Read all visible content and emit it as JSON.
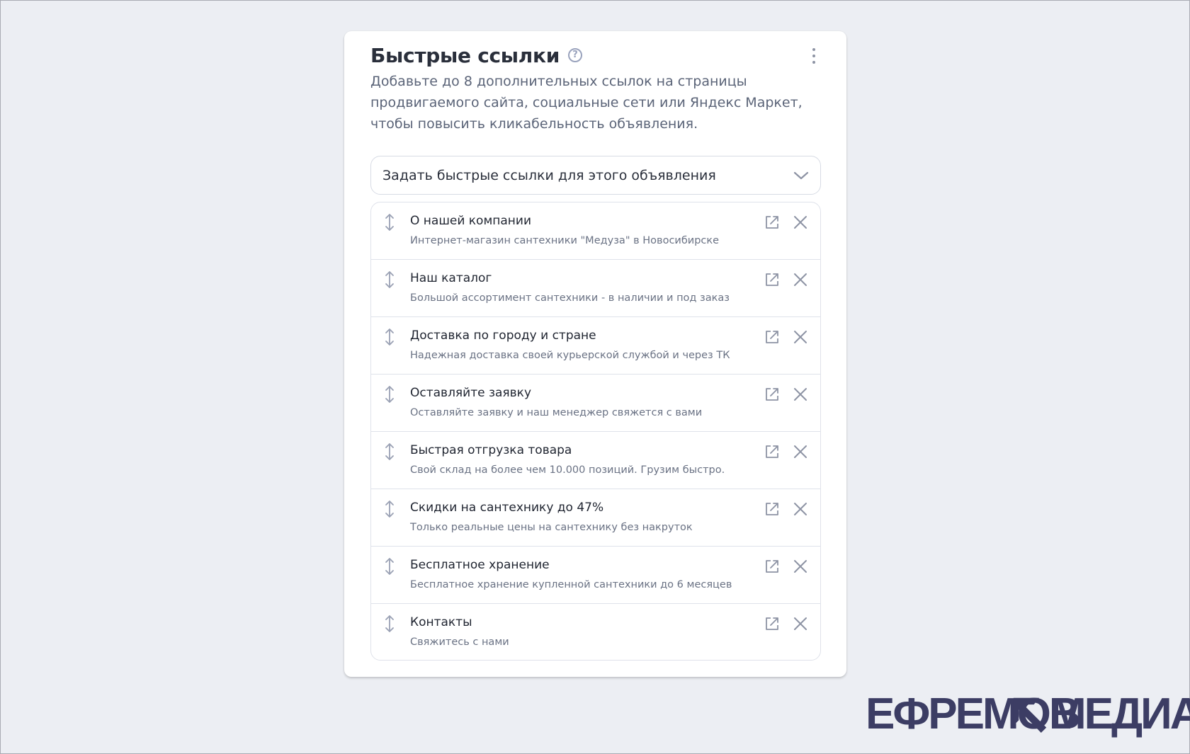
{
  "card": {
    "title": "Быстрые ссылки",
    "help_icon": "question-circle-icon",
    "menu_icon": "more-vertical-icon",
    "description": "Добавьте до 8 дополнительных ссылок на страницы продвигаемого сайта, социальные сети или Яндекс Маркет, чтобы повысить кликабельность объявления.",
    "dropdown": {
      "label": "Задать быстрые ссылки для этого объявления",
      "icon": "chevron-down-icon"
    }
  },
  "links": [
    {
      "title": "О нашей компании",
      "description": "Интернет-магазин сантехники \"Медуза\" в Новосибирске"
    },
    {
      "title": "Наш каталог",
      "description": "Большой ассортимент сантехники - в наличии и под заказ"
    },
    {
      "title": "Доставка по городу и стране",
      "description": "Надежная доставка своей курьерской службой и через ТК"
    },
    {
      "title": "Оставляйте заявку",
      "description": "Оставляйте заявку и наш менеджер свяжется с вами"
    },
    {
      "title": "Быстрая отгрузка товара",
      "description": "Свой склад на более чем 10.000 позиций. Грузим быстро."
    },
    {
      "title": "Скидки на сантехнику до 47%",
      "description": "Только реальные цены на сантехнику без накруток"
    },
    {
      "title": "Бесплатное хранение",
      "description": "Бесплатное хранение купленной сантехники до 6 месяцев"
    },
    {
      "title": "Контакты",
      "description": "Свяжитесь с нами"
    }
  ],
  "row_icons": {
    "drag": "drag-vertical-icon",
    "open": "external-link-icon",
    "remove": "close-icon"
  },
  "logo": {
    "left": "ЕФРЕМОВ",
    "right": "МЕДИА",
    "color": "#3c3d64"
  },
  "colors": {
    "background": "#eceef3",
    "card": "#ffffff",
    "icon": "#8d93a4",
    "border": "#dfe2ea"
  }
}
